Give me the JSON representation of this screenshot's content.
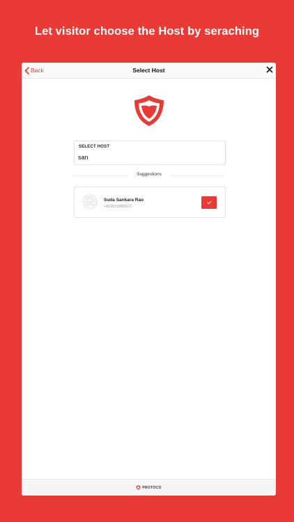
{
  "headline": "Let visitor choose the Host by seraching",
  "navbar": {
    "back_label": "Back",
    "title": "Select Host",
    "close_icon": "close-icon"
  },
  "logo_icon": "shield-logo-icon",
  "host_field": {
    "label": "SELECT HOST",
    "value": "san"
  },
  "suggestions": {
    "heading": "Suggestions",
    "items": [
      {
        "name": "Suda Sankara Rao",
        "phone": "+919019955622",
        "avatar_icon": "user-avatar-icon",
        "select_icon": "check-icon"
      }
    ]
  },
  "footer": {
    "brand": "PROTOCO",
    "brand_icon": "protoco-logo-icon"
  },
  "colors": {
    "accent": "#e93a35",
    "background": "#e93a35",
    "card": "#ffffff"
  }
}
